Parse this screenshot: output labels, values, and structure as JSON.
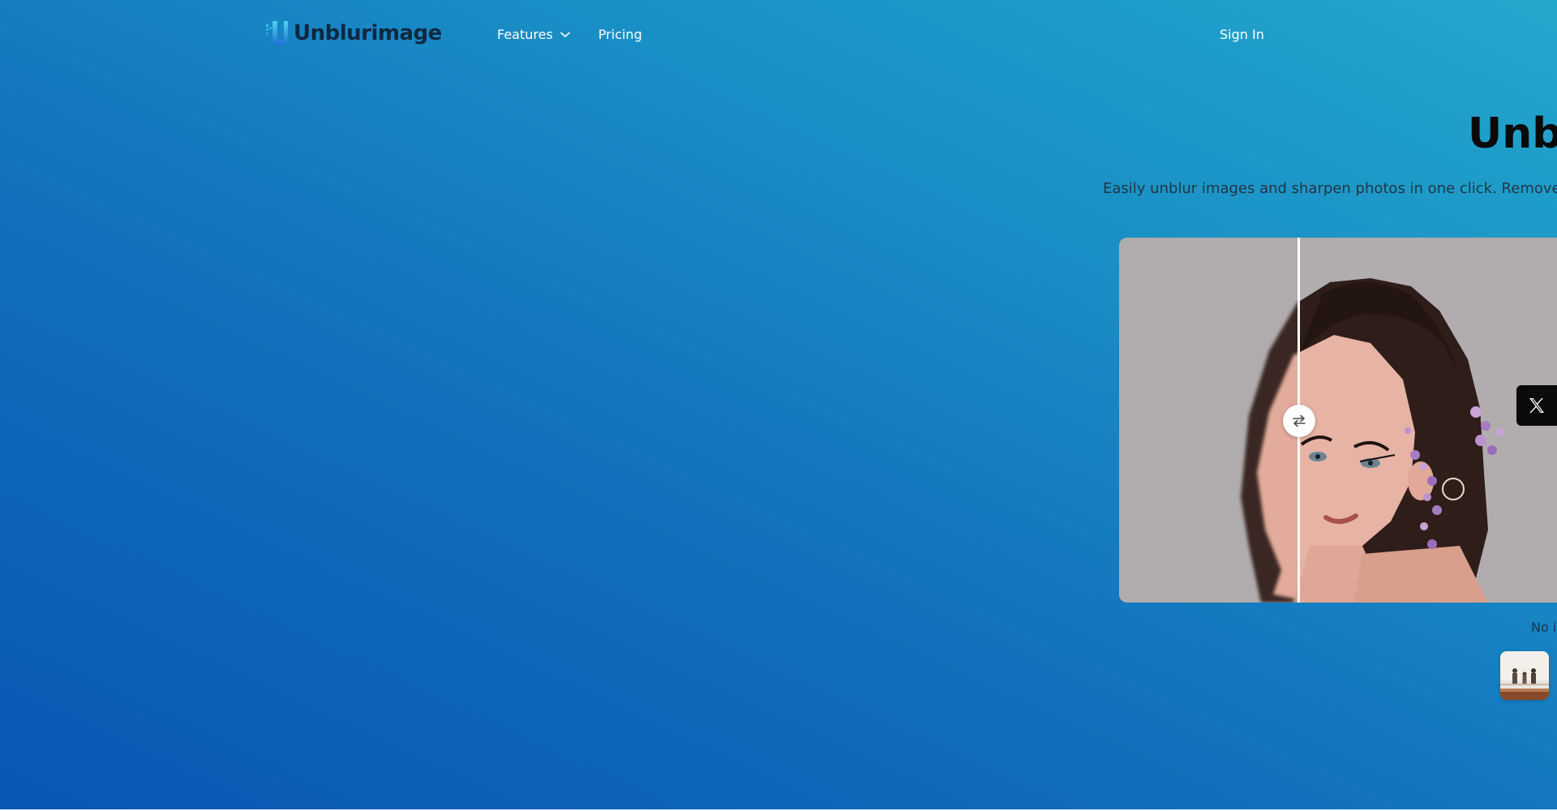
{
  "header": {
    "logo_text": "Unblurimage",
    "logo_icon": "u-logo-icon",
    "nav": [
      {
        "label": "Features",
        "icon": "chevron-down-icon"
      },
      {
        "label": "Pricing"
      }
    ],
    "sign_in_label": "Sign In"
  },
  "hero": {
    "title": "Unb",
    "subtitle": "Easily unblur images and sharpen photos in one click. Remove"
  },
  "compare": {
    "handle_icon": "swap-arrows-icon",
    "split": 0.36
  },
  "share": {
    "icon": "x-logo-icon"
  },
  "samples": {
    "label": "No i",
    "thumb_icon": "sample-image-thumbnail"
  },
  "colors": {
    "background_top": "#22a7cc",
    "background_bottom": "#0a56b4",
    "logo_text": "#0f2740",
    "logo_accent": "#1fb6e0",
    "nav_text": "#ffffff",
    "title_text": "#0a0a0a",
    "subtitle_text": "#233545",
    "share_button": "#0a0a0a"
  }
}
